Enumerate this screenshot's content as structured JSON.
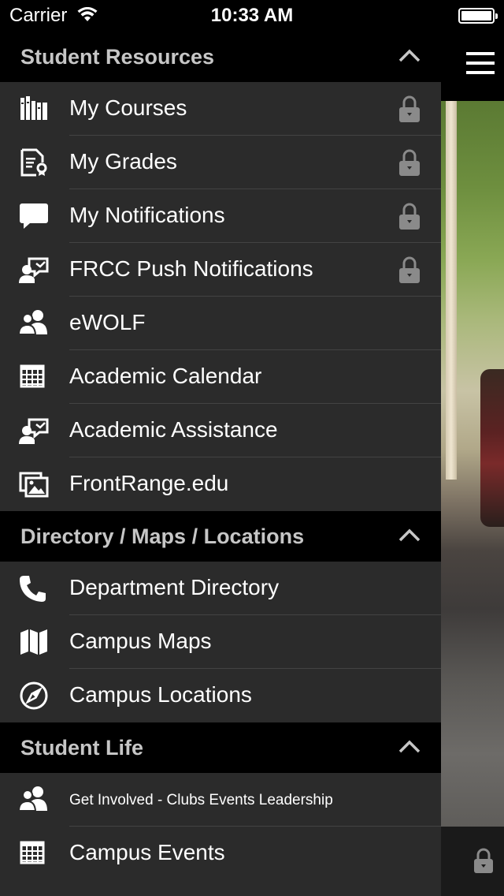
{
  "status_bar": {
    "carrier": "Carrier",
    "time": "10:33 AM"
  },
  "sections": [
    {
      "title": "Student Resources",
      "items": [
        {
          "label": "My Courses",
          "icon": "books-icon",
          "locked": true
        },
        {
          "label": "My Grades",
          "icon": "grade-certificate-icon",
          "locked": true
        },
        {
          "label": "My Notifications",
          "icon": "speech-bubble-icon",
          "locked": true
        },
        {
          "label": "FRCC Push Notifications",
          "icon": "presenter-icon",
          "locked": true
        },
        {
          "label": "eWOLF",
          "icon": "people-icon",
          "locked": false
        },
        {
          "label": "Academic Calendar",
          "icon": "calendar-grid-icon",
          "locked": false
        },
        {
          "label": "Academic Assistance",
          "icon": "presenter-icon",
          "locked": false
        },
        {
          "label": "FrontRange.edu",
          "icon": "web-image-icon",
          "locked": false
        }
      ]
    },
    {
      "title": "Directory / Maps / Locations",
      "items": [
        {
          "label": "Department Directory",
          "icon": "phone-icon",
          "locked": false
        },
        {
          "label": "Campus Maps",
          "icon": "map-icon",
          "locked": false
        },
        {
          "label": "Campus Locations",
          "icon": "compass-icon",
          "locked": false
        }
      ]
    },
    {
      "title": "Student Life",
      "items": [
        {
          "label": "Get Involved - Clubs Events Leadership",
          "icon": "people-icon",
          "locked": false
        },
        {
          "label": "Campus Events",
          "icon": "calendar-grid-icon",
          "locked": false
        }
      ]
    }
  ],
  "colors": {
    "drawer_bg": "#2b2b2b",
    "header_bg": "#000000",
    "header_text": "#c6c6c6",
    "lock": "#8a8a8a"
  }
}
